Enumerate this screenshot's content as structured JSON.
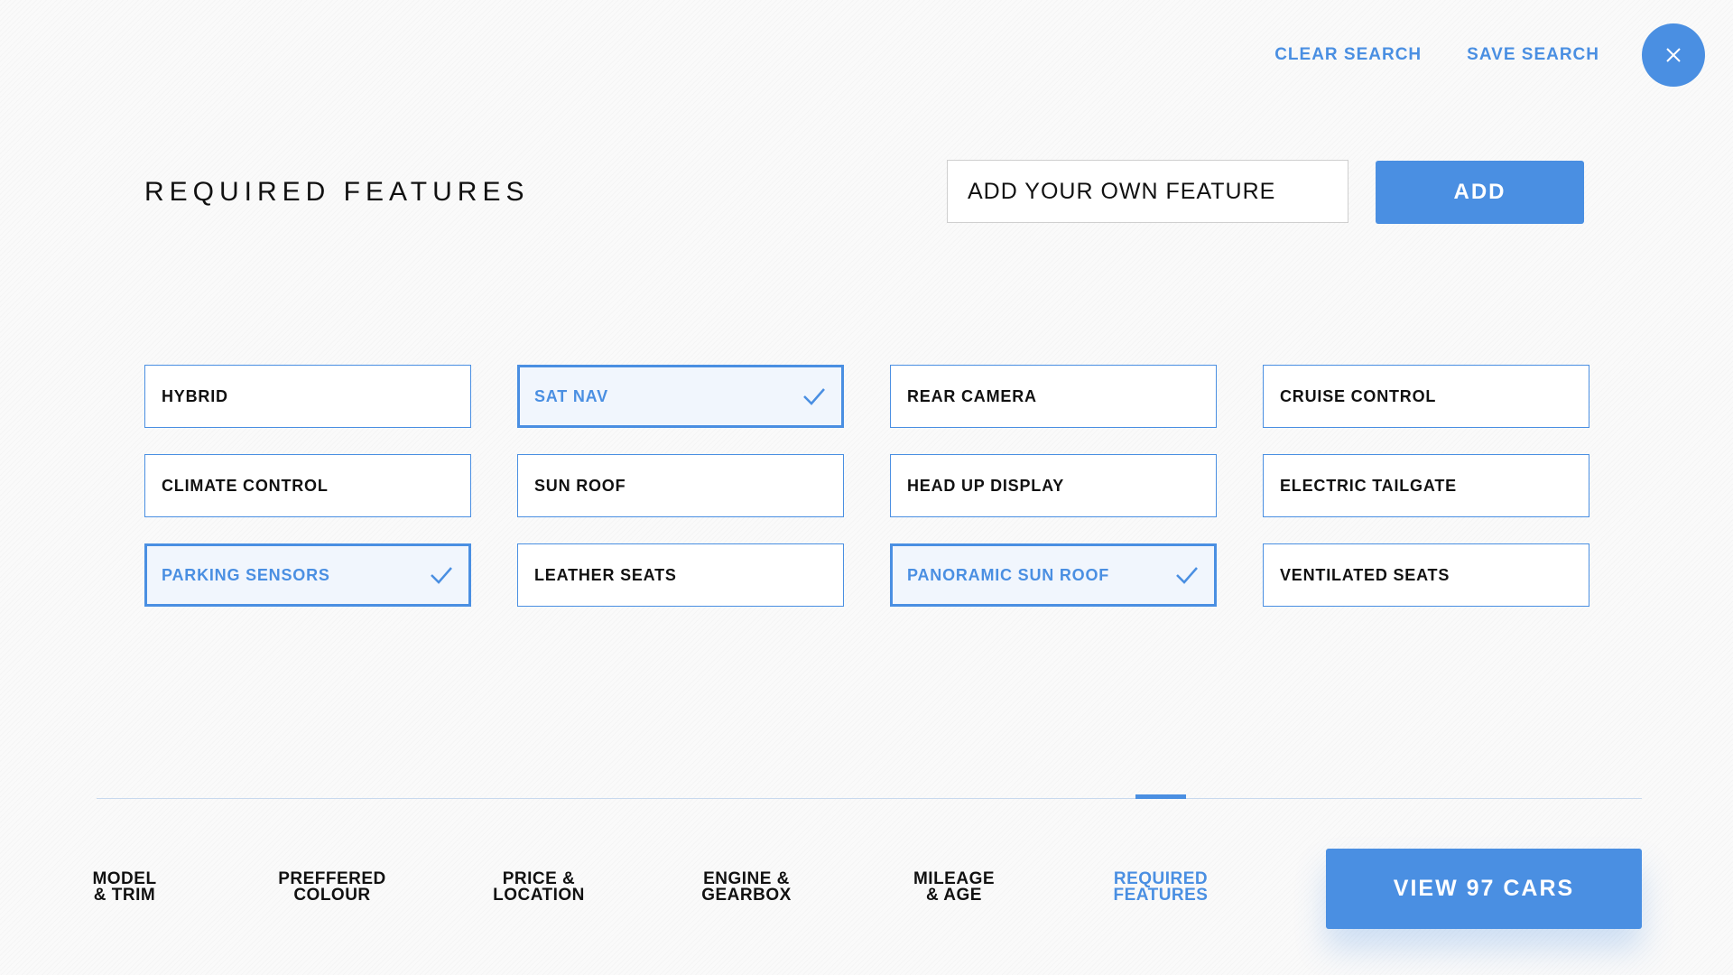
{
  "header": {
    "clear_search": "CLEAR SEARCH",
    "save_search": "SAVE SEARCH"
  },
  "colors": {
    "accent": "#4a8fe2",
    "text": "#111111",
    "background": "#fafafa"
  },
  "page": {
    "title": "REQUIRED FEATURES",
    "input_placeholder": "ADD YOUR OWN FEATURE",
    "add_button": "ADD"
  },
  "features": [
    {
      "label": "HYBRID",
      "selected": false
    },
    {
      "label": "SAT NAV",
      "selected": true
    },
    {
      "label": "REAR CAMERA",
      "selected": false
    },
    {
      "label": "CRUISE CONTROL",
      "selected": false
    },
    {
      "label": "CLIMATE CONTROL",
      "selected": false
    },
    {
      "label": "SUN ROOF",
      "selected": false
    },
    {
      "label": "HEAD UP DISPLAY",
      "selected": false
    },
    {
      "label": "ELECTRIC TAILGATE",
      "selected": false
    },
    {
      "label": "PARKING SENSORS",
      "selected": true
    },
    {
      "label": "LEATHER SEATS",
      "selected": false
    },
    {
      "label": "PANORAMIC SUN ROOF",
      "selected": true
    },
    {
      "label": "VENTILATED SEATS",
      "selected": false
    }
  ],
  "steps": [
    {
      "line1": "MODEL",
      "line2": "& TRIM",
      "active": false
    },
    {
      "line1": "PREFFERED",
      "line2": "COLOUR",
      "active": false
    },
    {
      "line1": "PRICE &",
      "line2": "LOCATION",
      "active": false
    },
    {
      "line1": "ENGINE &",
      "line2": "GEARBOX",
      "active": false
    },
    {
      "line1": "MILEAGE",
      "line2": "& AGE",
      "active": false
    },
    {
      "line1": "REQUIRED",
      "line2": "FEATURES",
      "active": true
    }
  ],
  "footer": {
    "view_button": "VIEW 97 CARS"
  }
}
